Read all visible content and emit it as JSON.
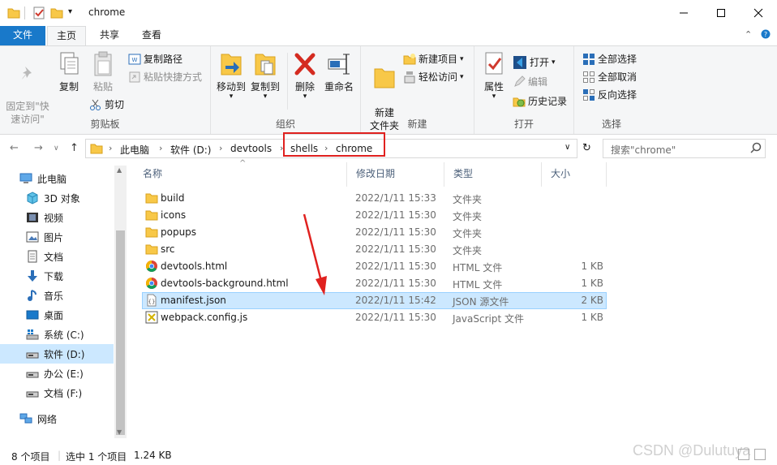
{
  "window": {
    "title": "chrome"
  },
  "tabs": {
    "file": "文件",
    "home": "主页",
    "share": "共享",
    "view": "查看"
  },
  "ribbon": {
    "clipboard": {
      "pin": "固定到\"快\n速访问\"",
      "copy": "复制",
      "paste": "粘贴",
      "copy_path": "复制路径",
      "paste_shortcut": "粘贴快捷方式",
      "cut": "剪切",
      "label": "剪贴板"
    },
    "organize": {
      "move_to": "移动到",
      "copy_to": "复制到",
      "delete": "删除",
      "rename": "重命名",
      "label": "组织"
    },
    "new": {
      "new_folder": "新建\n文件夹",
      "new_item": "新建项目",
      "easy_access": "轻松访问",
      "label": "新建"
    },
    "open": {
      "properties": "属性",
      "open": "打开",
      "edit": "编辑",
      "history": "历史记录",
      "label": "打开"
    },
    "select": {
      "select_all": "全部选择",
      "select_none": "全部取消",
      "invert": "反向选择",
      "label": "选择"
    }
  },
  "address": {
    "crumbs": [
      "此电脑",
      "软件 (D:)",
      "devtools",
      "shells",
      "chrome"
    ],
    "search_placeholder": "搜索\"chrome\""
  },
  "navpane": {
    "items": [
      {
        "label": "此电脑",
        "icon": "computer-icon"
      },
      {
        "label": "3D 对象",
        "icon": "cube-icon"
      },
      {
        "label": "视频",
        "icon": "video-icon"
      },
      {
        "label": "图片",
        "icon": "picture-icon"
      },
      {
        "label": "文档",
        "icon": "document-icon"
      },
      {
        "label": "下载",
        "icon": "download-icon"
      },
      {
        "label": "音乐",
        "icon": "music-icon"
      },
      {
        "label": "桌面",
        "icon": "desktop-icon"
      },
      {
        "label": "系统 (C:)",
        "icon": "windows-drive-icon"
      },
      {
        "label": "软件 (D:)",
        "icon": "drive-icon"
      },
      {
        "label": "办公 (E:)",
        "icon": "drive-icon"
      },
      {
        "label": "文档 (F:)",
        "icon": "drive-icon"
      },
      {
        "label": "网络",
        "icon": "network-icon"
      }
    ]
  },
  "filelist": {
    "columns": {
      "name": "名称",
      "modified": "修改日期",
      "type": "类型",
      "size": "大小"
    },
    "rows": [
      {
        "name": "build",
        "modified": "2022/1/11 15:33",
        "type": "文件夹",
        "size": "",
        "icon": "folder-icon"
      },
      {
        "name": "icons",
        "modified": "2022/1/11 15:30",
        "type": "文件夹",
        "size": "",
        "icon": "folder-icon"
      },
      {
        "name": "popups",
        "modified": "2022/1/11 15:30",
        "type": "文件夹",
        "size": "",
        "icon": "folder-icon"
      },
      {
        "name": "src",
        "modified": "2022/1/11 15:30",
        "type": "文件夹",
        "size": "",
        "icon": "folder-icon"
      },
      {
        "name": "devtools.html",
        "modified": "2022/1/11 15:30",
        "type": "HTML 文件",
        "size": "1 KB",
        "icon": "chrome-icon"
      },
      {
        "name": "devtools-background.html",
        "modified": "2022/1/11 15:30",
        "type": "HTML 文件",
        "size": "1 KB",
        "icon": "chrome-icon"
      },
      {
        "name": "manifest.json",
        "modified": "2022/1/11 15:42",
        "type": "JSON 源文件",
        "size": "2 KB",
        "icon": "json-file-icon"
      },
      {
        "name": "webpack.config.js",
        "modified": "2022/1/11 15:30",
        "type": "JavaScript 文件",
        "size": "1 KB",
        "icon": "js-file-icon"
      }
    ]
  },
  "status": {
    "count": "8 个项目",
    "selection": "选中 1 个项目",
    "size": "1.24 KB"
  },
  "watermark": "CSDN @Dulutuya",
  "colors": {
    "accent": "#1979ca",
    "selection": "#cce8ff",
    "highlight_box": "#e0211f",
    "folder": "#f8c848"
  }
}
